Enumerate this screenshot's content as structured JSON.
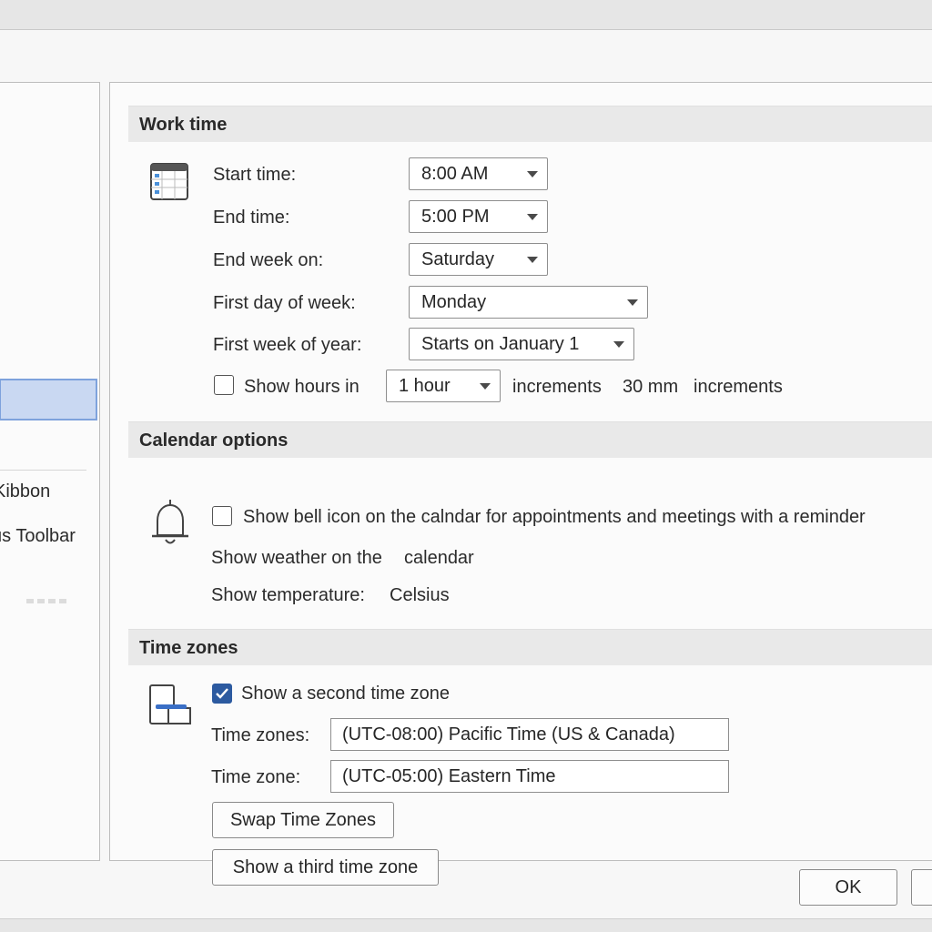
{
  "left_pane": {
    "items": [
      {
        "label": "Kibbon"
      },
      {
        "label": "us Toolbar"
      }
    ]
  },
  "work_time": {
    "header": "Work time",
    "start_time": {
      "label": "Start time:",
      "value": "8:00 AM"
    },
    "end_time": {
      "label": "End time:",
      "value": "5:00 PM"
    },
    "end_week_on": {
      "label": "End week on:",
      "value": "Saturday"
    },
    "first_day_of_week": {
      "label": "First day of week:",
      "value": "Monday"
    },
    "first_week_of_year": {
      "label": "First week of year:",
      "value": "Starts on January 1"
    },
    "show_hours": {
      "label": "Show hours in",
      "checked": false,
      "value": "1 hour",
      "suffix": "increments",
      "extra_value": "30 mm",
      "extra_suffix": "increments"
    }
  },
  "calendar_options": {
    "header": "Calendar options",
    "show_bell": {
      "label": "Show bell icon on the calndar for appointments and meetings with a reminder",
      "checked": false
    },
    "show_weather": {
      "label": "Show weather on the",
      "value": "calendar"
    },
    "show_temperature": {
      "label": "Show temperature:",
      "value": "Celsius"
    }
  },
  "time_zones": {
    "header": "Time zones",
    "show_second": {
      "label": "Show a second time zone",
      "checked": true
    },
    "zone1": {
      "label": "Time zones:",
      "value": "(UTC-08:00) Pacific Time (US & Canada)"
    },
    "zone2": {
      "label": "Time zone:",
      "value": "(UTC-05:00) Eastern Time"
    },
    "swap_label": "Swap Time Zones",
    "third_label": "Show a third time zone"
  },
  "footer": {
    "ok_label": "OK"
  },
  "icons": {
    "calendar": "calendar-icon",
    "bell": "bell-icon",
    "timezone": "time-zone-icon",
    "caret": "chevron-down-icon",
    "check": "checkmark-icon"
  },
  "colors": {
    "accent": "#2c5aa0",
    "selected_nav": "#c9d8f2",
    "section_header": "#e9e9e9"
  }
}
